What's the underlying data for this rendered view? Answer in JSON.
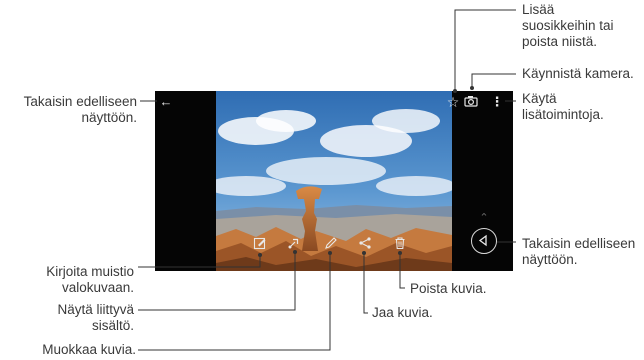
{
  "labels": {
    "back_left": "Takaisin edelliseen\nnäyttöön.",
    "favorites": "Lisää\nsuosikkeihin tai\npoista niistä.",
    "camera": "Käynnistä kamera.",
    "more": "Käytä\nlisätoimintoja.",
    "back_right": "Takaisin edelliseen\nnäyttöön.",
    "memo": "Kirjoita muistio\nvalokuvaan.",
    "related": "Näytä liittyvä\nsisältö.",
    "edit": "Muokkaa kuvia.",
    "delete": "Poista kuvia.",
    "share": "Jaa kuvia."
  },
  "icons": {
    "back_arrow": "back-arrow-icon",
    "star": "star-icon",
    "camera": "camera-icon",
    "more": "more-vertical-icon",
    "memo": "memo-icon",
    "related": "related-content-icon",
    "edit": "edit-pencil-icon",
    "share": "share-icon",
    "delete": "trash-icon",
    "nav_back": "navigation-back-icon",
    "expand": "chevron-up-icon"
  },
  "colors": {
    "callout_line": "#333333",
    "sky": "#4a86c4",
    "rock": "#b0642c",
    "phone_bg": "#050505"
  }
}
